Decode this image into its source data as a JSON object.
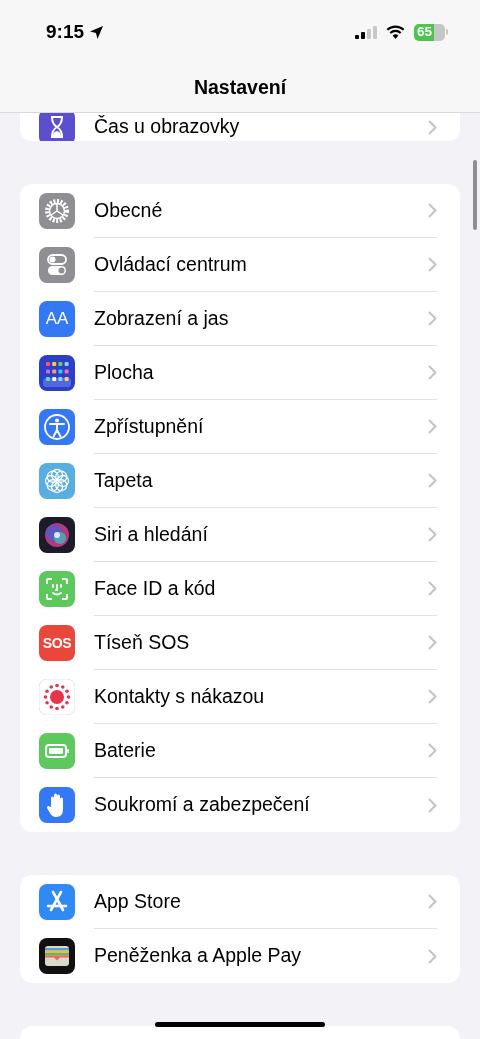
{
  "status_bar": {
    "time": "9:15",
    "battery": "65"
  },
  "navigation": {
    "title": "Nastavení"
  },
  "partial_group": {
    "rows": [
      {
        "label": "Čas u obrazovky",
        "kind": "hourglass"
      }
    ]
  },
  "groups": [
    {
      "rows": [
        {
          "label": "Obecné",
          "kind": "gear"
        },
        {
          "label": "Ovládací centrum",
          "kind": "toggles"
        },
        {
          "label": "Zobrazení a jas",
          "kind": "text",
          "icon_text": "AA"
        },
        {
          "label": "Plocha",
          "kind": "grid"
        },
        {
          "label": "Zpřístupnění",
          "kind": "accessibility"
        },
        {
          "label": "Tapeta",
          "kind": "flower"
        },
        {
          "label": "Siri a hledání",
          "kind": "orb"
        },
        {
          "label": "Face ID a kód",
          "kind": "face"
        },
        {
          "label": "Tíseň SOS",
          "kind": "text",
          "icon_text": "SOS"
        },
        {
          "label": "Kontakty s nákazou",
          "kind": "dots"
        },
        {
          "label": "Baterie",
          "kind": "battery"
        },
        {
          "label": "Soukromí a zabezpečení",
          "kind": "hand"
        }
      ]
    },
    {
      "rows": [
        {
          "label": "App Store",
          "kind": "appstore"
        },
        {
          "label": "Peněženka a Apple Pay",
          "kind": "wallet"
        }
      ]
    }
  ]
}
